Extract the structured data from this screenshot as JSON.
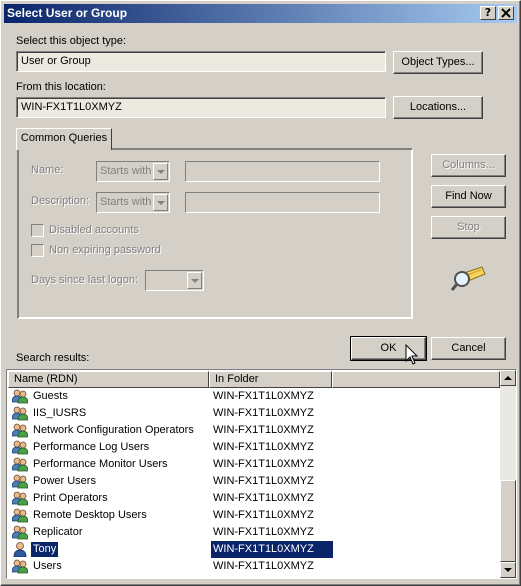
{
  "window": {
    "title": "Select User or Group",
    "help_label": "?",
    "close_label": "X"
  },
  "object_type": {
    "label": "Select this object type:",
    "value": "User or Group",
    "button": "Object Types..."
  },
  "location": {
    "label": "From this location:",
    "value": "WIN-FX1T1L0XMYZ",
    "button": "Locations..."
  },
  "common_queries": {
    "tab_label": "Common Queries",
    "name_label": "Name:",
    "name_mode": "Starts with",
    "description_label": "Description:",
    "description_mode": "Starts with",
    "disabled_accounts_label": "Disabled accounts",
    "non_expiring_label": "Non expiring password",
    "days_label": "Days since last logon:"
  },
  "side_buttons": {
    "columns": "Columns...",
    "find_now": "Find Now",
    "stop": "Stop"
  },
  "dialog_buttons": {
    "ok": "OK",
    "cancel": "Cancel"
  },
  "results": {
    "label": "Search results:",
    "columns": [
      "Name (RDN)",
      "In Folder"
    ],
    "rows": [
      {
        "name": "Guests",
        "folder": "WIN-FX1T1L0XMYZ",
        "icon": "group-icon"
      },
      {
        "name": "IIS_IUSRS",
        "folder": "WIN-FX1T1L0XMYZ",
        "icon": "group-icon"
      },
      {
        "name": "Network Configuration Operators",
        "folder": "WIN-FX1T1L0XMYZ",
        "icon": "group-icon"
      },
      {
        "name": "Performance Log Users",
        "folder": "WIN-FX1T1L0XMYZ",
        "icon": "group-icon"
      },
      {
        "name": "Performance Monitor Users",
        "folder": "WIN-FX1T1L0XMYZ",
        "icon": "group-icon"
      },
      {
        "name": "Power Users",
        "folder": "WIN-FX1T1L0XMYZ",
        "icon": "group-icon"
      },
      {
        "name": "Print Operators",
        "folder": "WIN-FX1T1L0XMYZ",
        "icon": "group-icon"
      },
      {
        "name": "Remote Desktop Users",
        "folder": "WIN-FX1T1L0XMYZ",
        "icon": "group-icon"
      },
      {
        "name": "Replicator",
        "folder": "WIN-FX1T1L0XMYZ",
        "icon": "group-icon"
      },
      {
        "name": "Tony",
        "folder": "WIN-FX1T1L0XMYZ",
        "icon": "user-icon",
        "selected": true
      },
      {
        "name": "Users",
        "folder": "WIN-FX1T1L0XMYZ",
        "icon": "group-icon"
      }
    ]
  },
  "colors": {
    "titlebar_start": "#0a246a",
    "titlebar_end": "#a6caf0",
    "selection": "#0a246a",
    "face": "#d4d0c8"
  }
}
